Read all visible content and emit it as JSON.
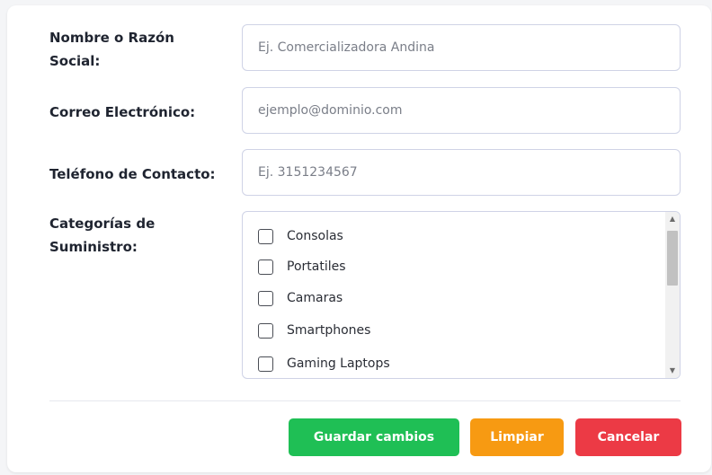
{
  "form": {
    "name_label": "Nombre o Razón Social:",
    "name_placeholder": "Ej. Comercializadora Andina",
    "email_label": "Correo Electrónico:",
    "email_placeholder": "ejemplo@dominio.com",
    "phone_label": "Teléfono de Contacto:",
    "phone_placeholder": "Ej. 3151234567",
    "categories_label": "Categorías de Suministro:",
    "categories": [
      {
        "label": "Consolas",
        "checked": false
      },
      {
        "label": "Portatiles",
        "checked": false
      },
      {
        "label": "Camaras",
        "checked": false
      },
      {
        "label": "Smartphones",
        "checked": false
      },
      {
        "label": "Gaming Laptops",
        "checked": false
      }
    ]
  },
  "actions": {
    "save_label": "Guardar cambios",
    "clear_label": "Limpiar",
    "cancel_label": "Cancelar"
  },
  "colors": {
    "save": "#1fbf55",
    "clear": "#f79a12",
    "cancel": "#ec3a45",
    "border": "#cfd3e6"
  },
  "icons": {
    "scroll_up": "triangle-up-icon",
    "scroll_down": "triangle-down-icon"
  }
}
